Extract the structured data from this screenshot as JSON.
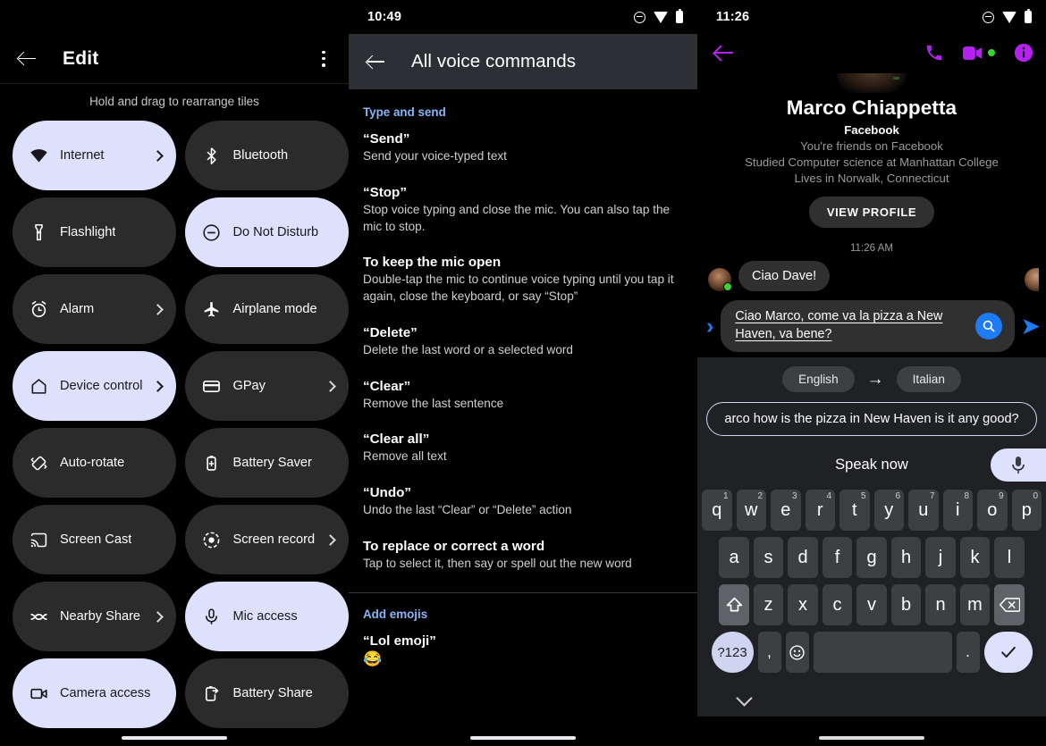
{
  "colors": {
    "accent_tile_active": "#dde1fb",
    "tile_inactive": "#2b2b2b",
    "messenger_purple": "#b521f0",
    "translate_blue": "#1d7bf5",
    "section_link_blue": "#8ab4f8",
    "online_green": "#38d430"
  },
  "panel_quick_settings": {
    "appbar": {
      "back_icon": "back-arrow-icon",
      "title": "Edit",
      "overflow_icon": "kebab-menu-icon"
    },
    "hint": "Hold and drag to rearrange tiles",
    "tiles": [
      {
        "label": "Internet",
        "icon": "wifi-icon",
        "active": true,
        "chevron": true
      },
      {
        "label": "Bluetooth",
        "icon": "bluetooth-icon",
        "active": false,
        "chevron": false
      },
      {
        "label": "Flashlight",
        "icon": "flashlight-icon",
        "active": false,
        "chevron": false
      },
      {
        "label": "Do Not Disturb",
        "icon": "dnd-icon",
        "active": true,
        "chevron": false
      },
      {
        "label": "Alarm",
        "icon": "alarm-clock-icon",
        "active": false,
        "chevron": true
      },
      {
        "label": "Airplane mode",
        "icon": "airplane-icon",
        "active": false,
        "chevron": false
      },
      {
        "label": "Device control",
        "icon": "home-icon",
        "active": true,
        "chevron": true
      },
      {
        "label": "GPay",
        "icon": "credit-card-icon",
        "active": false,
        "chevron": true
      },
      {
        "label": "Auto-rotate",
        "icon": "auto-rotate-icon",
        "active": false,
        "chevron": false
      },
      {
        "label": "Battery Saver",
        "icon": "battery-saver-icon",
        "active": false,
        "chevron": false
      },
      {
        "label": "Screen Cast",
        "icon": "screen-cast-icon",
        "active": false,
        "chevron": false
      },
      {
        "label": "Screen record",
        "icon": "screen-record-icon",
        "active": false,
        "chevron": true
      },
      {
        "label": "Nearby Share",
        "icon": "nearby-share-icon",
        "active": false,
        "chevron": true
      },
      {
        "label": "Mic access",
        "icon": "microphone-icon",
        "active": true,
        "chevron": false
      },
      {
        "label": "Camera access",
        "icon": "camera-icon",
        "active": true,
        "chevron": false
      },
      {
        "label": "Battery Share",
        "icon": "battery-share-icon",
        "active": false,
        "chevron": false
      }
    ]
  },
  "panel_voice_commands": {
    "statusbar": {
      "clock": "10:49",
      "icons": [
        "dnd-icon",
        "wifi-icon",
        "battery-icon"
      ]
    },
    "appbar": {
      "back_icon": "back-arrow-icon",
      "title": "All voice commands"
    },
    "section_1_title": "Type and send",
    "items_1": [
      {
        "cmd": "“Send”",
        "desc": "Send your voice-typed text"
      },
      {
        "cmd": "“Stop”",
        "desc": "Stop voice typing and close the mic. You can also tap the mic to stop."
      },
      {
        "cmd": "To keep the mic open",
        "desc": "Double-tap the mic to continue voice typing until you tap it again, close the keyboard, or say “Stop”"
      },
      {
        "cmd": "“Delete”",
        "desc": "Delete the last word or a selected word"
      },
      {
        "cmd": "“Clear”",
        "desc": "Remove the last sentence"
      },
      {
        "cmd": "“Clear all”",
        "desc": "Remove all text"
      },
      {
        "cmd": "“Undo”",
        "desc": "Undo the last “Clear” or “Delete” action"
      },
      {
        "cmd": "To replace or correct a word",
        "desc": "Tap to select it, then say or spell out the new word"
      }
    ],
    "section_2_title": "Add emojis",
    "items_2": [
      {
        "cmd": "“Lol emoji”",
        "emoji": "😂"
      }
    ]
  },
  "panel_messenger": {
    "statusbar": {
      "clock": "11:26",
      "icons": [
        "dnd-icon",
        "wifi-icon",
        "battery-icon"
      ]
    },
    "appbar": {
      "back_icon": "back-arrow-icon",
      "actions": [
        "phone-call-icon",
        "video-call-icon",
        "info-icon"
      ]
    },
    "profile": {
      "avatar": "contact-avatar",
      "name": "Marco Chiappetta",
      "source": "Facebook",
      "detail_lines": [
        "You're friends on Facebook",
        "Studied Computer science at Manhattan College",
        "Lives in Norwalk, Connecticut"
      ],
      "view_profile_button": "VIEW PROFILE"
    },
    "conversation": {
      "timestamp": "11:26 AM",
      "incoming_message": "Ciao Dave!",
      "translated_message": "Ciao Marco, come va la pizza a New Haven, va bene?",
      "search_icon": "search-icon",
      "expand_icon": "chevron-right-icon",
      "send_icon": "send-icon"
    },
    "translate_bar": {
      "source_language": "English",
      "arrow": "arrow-right-icon",
      "target_language": "Italian",
      "transcribed_text": "arco how is the pizza in New Haven is it any good?"
    },
    "voice_input": {
      "prompt": "Speak now",
      "mic_icon": "microphone-icon"
    },
    "keyboard": {
      "row1": [
        {
          "key": "q",
          "sup": "1"
        },
        {
          "key": "w",
          "sup": "2"
        },
        {
          "key": "e",
          "sup": "3"
        },
        {
          "key": "r",
          "sup": "4"
        },
        {
          "key": "t",
          "sup": "5"
        },
        {
          "key": "y",
          "sup": "6"
        },
        {
          "key": "u",
          "sup": "7"
        },
        {
          "key": "i",
          "sup": "8"
        },
        {
          "key": "o",
          "sup": "9"
        },
        {
          "key": "p",
          "sup": "0"
        }
      ],
      "row2": [
        "a",
        "s",
        "d",
        "f",
        "g",
        "h",
        "j",
        "k",
        "l"
      ],
      "row3": {
        "shift": "shift-icon",
        "keys": [
          "z",
          "x",
          "c",
          "v",
          "b",
          "n",
          "m"
        ],
        "backspace": "backspace-icon"
      },
      "row4": {
        "symbols": "?123",
        "comma": ",",
        "emoji": "emoji-icon",
        "space": "",
        "period": ".",
        "enter": "checkmark-icon"
      },
      "collapse_icon": "chevron-down-icon"
    }
  }
}
